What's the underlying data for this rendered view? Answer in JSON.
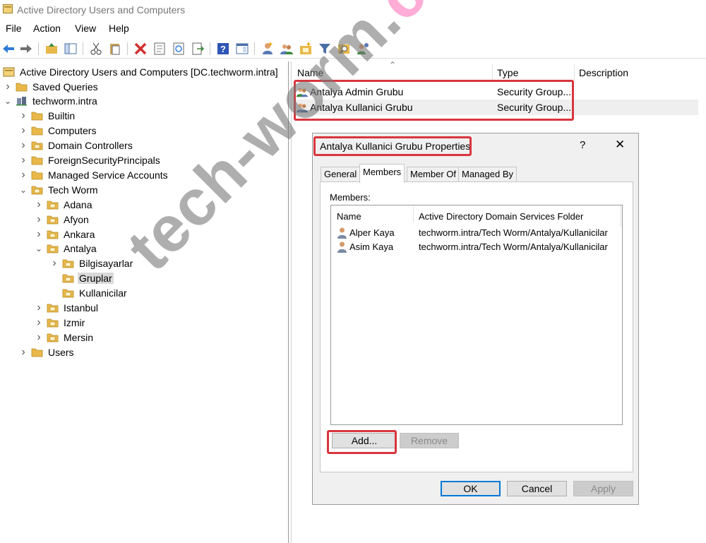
{
  "window": {
    "title": "Active Directory Users and Computers"
  },
  "menu": [
    "File",
    "Action",
    "View",
    "Help"
  ],
  "toolbar": {
    "icons": [
      "back-icon",
      "forward-icon",
      "up-folder-icon",
      "show-tree-icon",
      "cut-icon",
      "paste-icon",
      "delete-icon",
      "properties-icon",
      "refresh-icon",
      "export-icon",
      "help-icon",
      "console-icon",
      "new-user-icon",
      "new-group-icon",
      "new-ou-icon",
      "filter-icon",
      "find-icon",
      "add-to-group-icon"
    ]
  },
  "tree": {
    "root": "Active Directory Users and Computers [DC.techworm.intra]",
    "items": [
      {
        "label": "Saved Queries",
        "level": 1,
        "chev": "right"
      },
      {
        "label": "techworm.intra",
        "level": 1,
        "chev": "down"
      },
      {
        "label": "Builtin",
        "level": 2,
        "chev": "right"
      },
      {
        "label": "Computers",
        "level": 2,
        "chev": "right"
      },
      {
        "label": "Domain Controllers",
        "level": 2,
        "chev": "right"
      },
      {
        "label": "ForeignSecurityPrincipals",
        "level": 2,
        "chev": "right"
      },
      {
        "label": "Managed Service Accounts",
        "level": 2,
        "chev": "right"
      },
      {
        "label": "Tech Worm",
        "level": 2,
        "chev": "down"
      },
      {
        "label": "Adana",
        "level": 3,
        "chev": "right"
      },
      {
        "label": "Afyon",
        "level": 3,
        "chev": "right"
      },
      {
        "label": "Ankara",
        "level": 3,
        "chev": "right"
      },
      {
        "label": "Antalya",
        "level": 3,
        "chev": "down"
      },
      {
        "label": "Bilgisayarlar",
        "level": 4,
        "chev": "right"
      },
      {
        "label": "Gruplar",
        "level": 4,
        "chev": "none",
        "selected": true
      },
      {
        "label": "Kullanicilar",
        "level": 4,
        "chev": "none"
      },
      {
        "label": "Istanbul",
        "level": 3,
        "chev": "right"
      },
      {
        "label": "Izmir",
        "level": 3,
        "chev": "right"
      },
      {
        "label": "Mersin",
        "level": 3,
        "chev": "right"
      },
      {
        "label": "Users",
        "level": 2,
        "chev": "right"
      }
    ]
  },
  "list": {
    "columns": {
      "name": "Name",
      "type": "Type",
      "description": "Description"
    },
    "rows": [
      {
        "name": "Antalya Admin Grubu",
        "type": "Security Group..."
      },
      {
        "name": "Antalya Kullanici Grubu",
        "type": "Security Group..."
      }
    ]
  },
  "dialog": {
    "title": "Antalya Kullanici Grubu Properties",
    "help": "?",
    "close": "✕",
    "tabs": [
      "General",
      "Members",
      "Member Of",
      "Managed By"
    ],
    "members_label": "Members:",
    "columns": {
      "name": "Name",
      "folder": "Active Directory Domain Services Folder"
    },
    "members": [
      {
        "name": "Alper Kaya",
        "folder": "techworm.intra/Tech Worm/Antalya/Kullanicilar"
      },
      {
        "name": "Asim Kaya",
        "folder": "techworm.intra/Tech Worm/Antalya/Kullanicilar"
      }
    ],
    "buttons": {
      "add": "Add...",
      "remove": "Remove",
      "ok": "OK",
      "cancel": "Cancel",
      "apply": "Apply"
    }
  },
  "watermark": {
    "part1": "tech-worm.",
    "part2": "com"
  },
  "colors": {
    "highlight": "#d9363e",
    "selection": "#d9d9d9",
    "focus": "#0078d7",
    "folder": "#e8b84a"
  }
}
